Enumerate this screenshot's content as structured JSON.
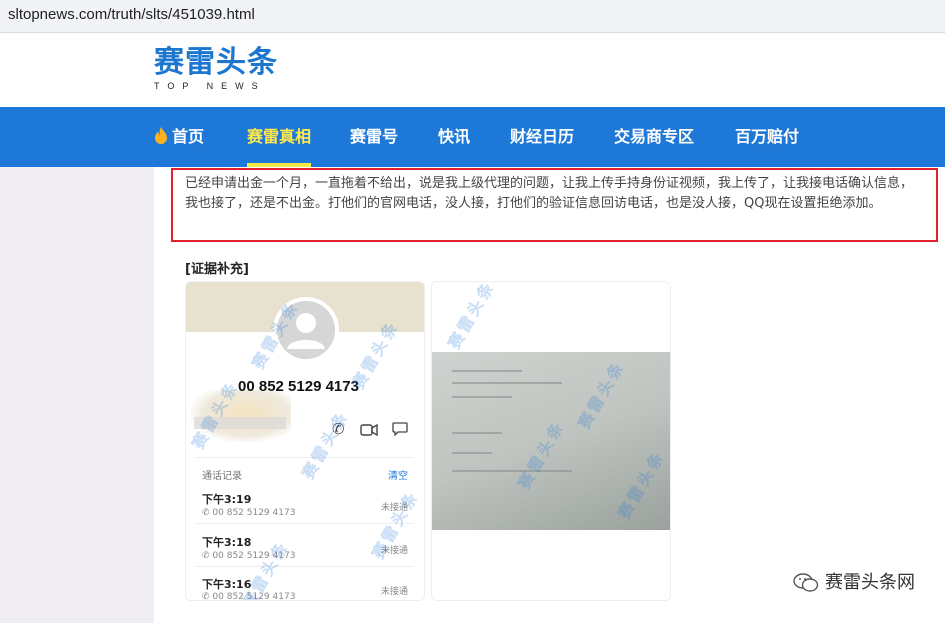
{
  "browser": {
    "url": "sltopnews.com/truth/slts/451039.html"
  },
  "logo": {
    "cn": "赛雷头条",
    "en": "TOP NEWS"
  },
  "nav": {
    "items": [
      {
        "label": "首页",
        "icon": "flame-icon"
      },
      {
        "label": "赛雷真相",
        "active": true
      },
      {
        "label": "赛雷号"
      },
      {
        "label": "快讯"
      },
      {
        "label": "财经日历"
      },
      {
        "label": "交易商专区"
      },
      {
        "label": "百万赔付"
      }
    ],
    "bg_color": "#1e78d7",
    "active_color": "#ffe84a"
  },
  "complaint": {
    "text": "已经申请出金一个月，一直拖着不给出，说是我上级代理的问题，让我上传手持身份证视频，我上传了，让我接电话确认信息，我也接了，还是不出金。打他们的官网电话，没人接，打他们的验证信息回访电话，也是没人接，QQ现在设置拒绝添加。",
    "border_color": "#e0202a"
  },
  "evidence": {
    "title": "[证据补充]",
    "card1": {
      "phone": "00 852 5129 4173",
      "call_log_label": "通话记录",
      "clear_label": "清空",
      "calls": [
        {
          "time": "下午3:19",
          "number": "00 852 5129 4173",
          "status": "未接通"
        },
        {
          "time": "下午3:18",
          "number": "00 852 5129 4173",
          "status": "未接通"
        },
        {
          "time": "下午3:16",
          "number": "00 852 5129 4173",
          "status": "未接通"
        }
      ]
    },
    "watermark": "赛雷头条"
  },
  "footer": {
    "brand": "赛雷头条网",
    "icon": "wechat-icon"
  }
}
